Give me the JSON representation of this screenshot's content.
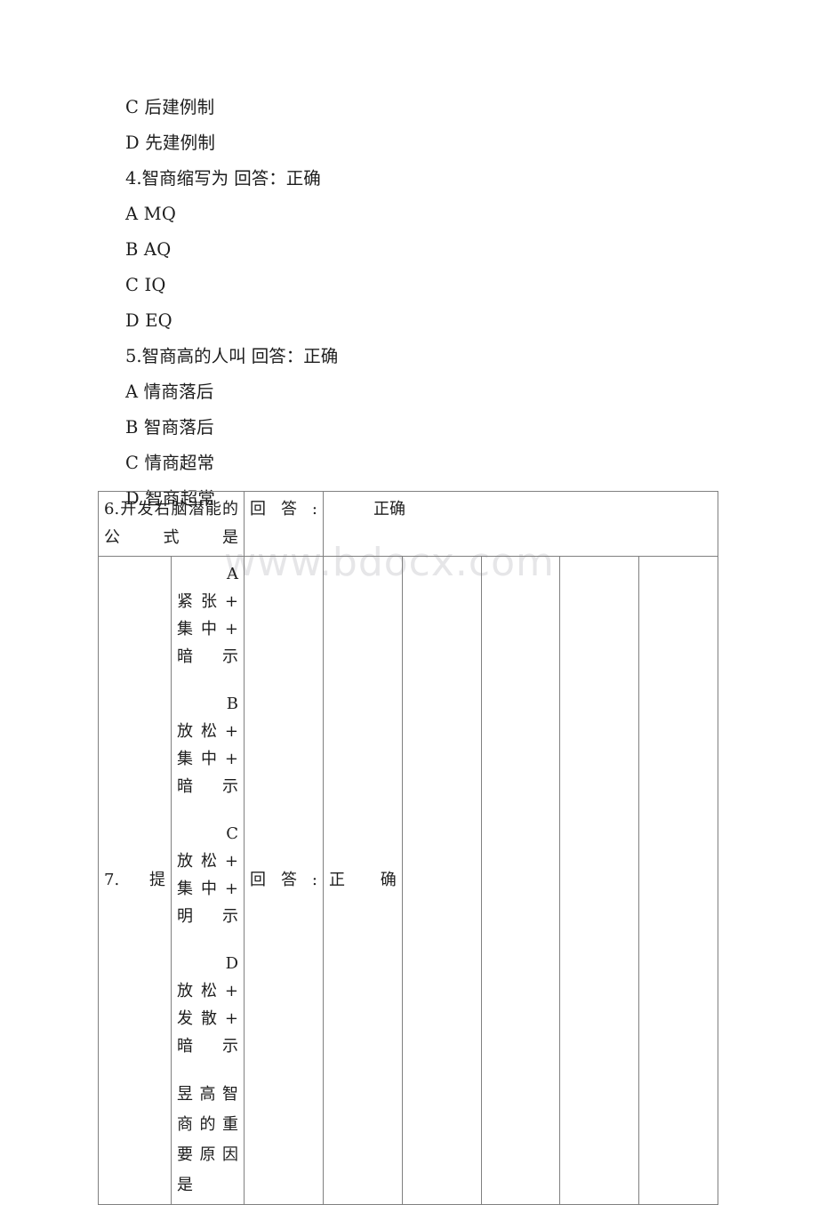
{
  "document": {
    "watermark": "www.bdocx.com"
  },
  "questions": [
    {
      "id": "c-option-3",
      "text": "C 后建例制"
    },
    {
      "id": "d-option-3",
      "text": "D 先建例制"
    },
    {
      "id": "question-4",
      "text": "4.智商缩写为 回答：正确"
    },
    {
      "id": "q4-a",
      "text": "A MQ"
    },
    {
      "id": "q4-b",
      "text": "B AQ"
    },
    {
      "id": "q4-c",
      "text": "C IQ"
    },
    {
      "id": "q4-d",
      "text": "D EQ"
    },
    {
      "id": "question-5",
      "text": "5.智商高的人叫 回答：正确"
    },
    {
      "id": "q5-a",
      "text": "A 情商落后"
    },
    {
      "id": "q5-b",
      "text": "B 智商落后"
    },
    {
      "id": "q5-c",
      "text": "C 情商超常"
    },
    {
      "id": "q5-d",
      "text": "D 智商超常"
    }
  ],
  "table": {
    "header": {
      "stem": "6.开发右脑潜能的公式是",
      "answer_label": "回答:",
      "result": "正确"
    },
    "body": {
      "number": "7.提",
      "options": [
        {
          "letter": "A",
          "lines": [
            "紧张+",
            "集中+",
            "暗示"
          ]
        },
        {
          "letter": "B",
          "lines": [
            "放松+",
            "集中+",
            "暗示"
          ]
        },
        {
          "letter": "C",
          "lines": [
            "放松+",
            "集中+",
            "明示"
          ]
        },
        {
          "letter": "D",
          "lines": [
            "放松+",
            "发散+",
            "暗示"
          ]
        }
      ],
      "trailing_text": "昱高智商的重要原因是",
      "answer_label": "回答:",
      "result": "正确",
      "empty_cells": [
        "",
        "",
        "",
        ""
      ]
    }
  }
}
